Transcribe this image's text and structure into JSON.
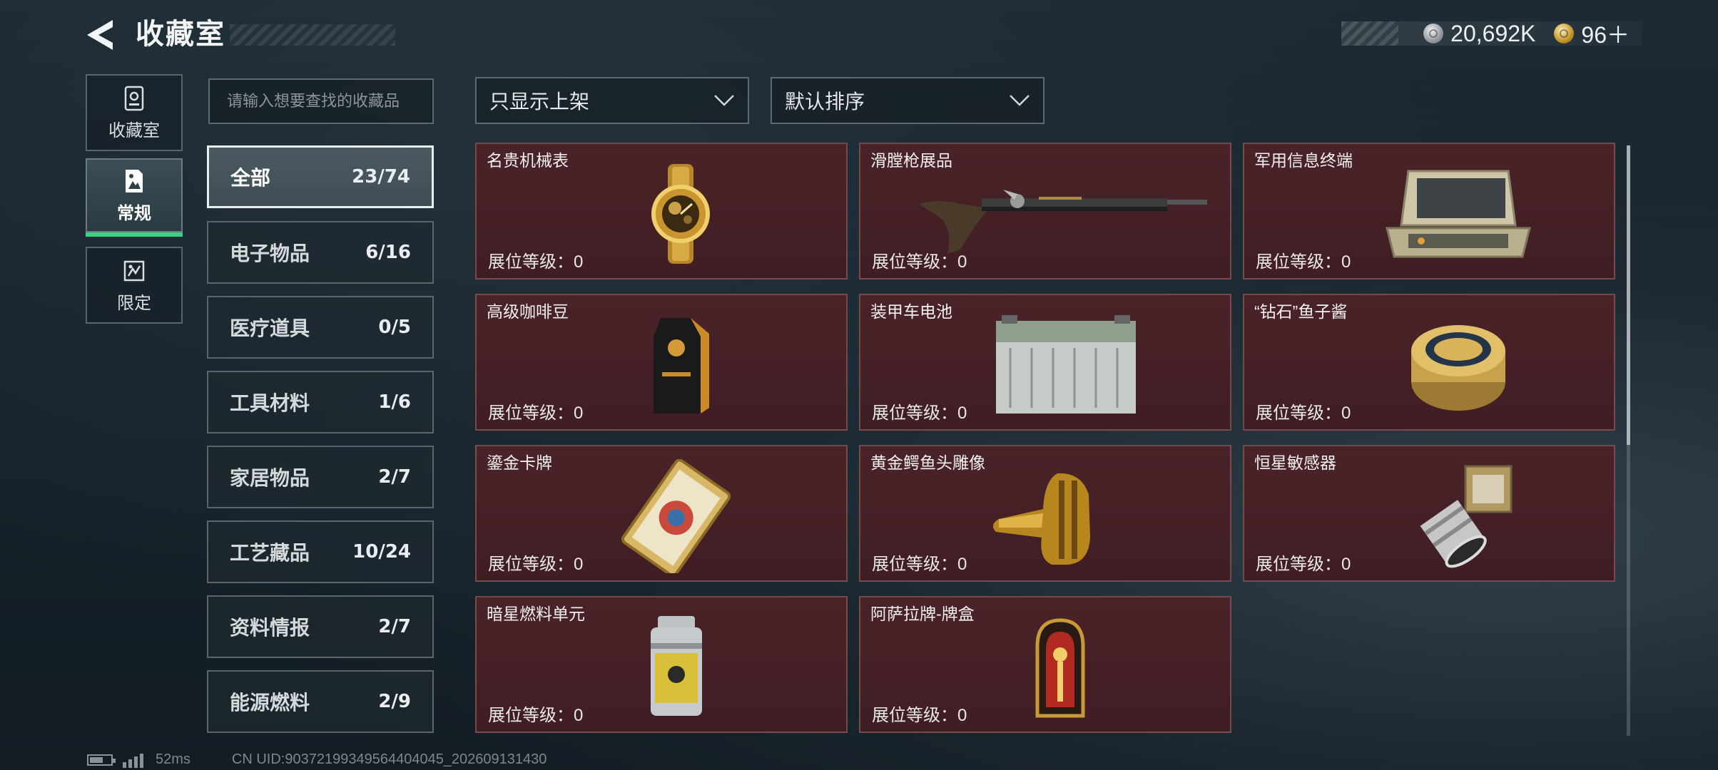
{
  "header": {
    "title": "收藏室"
  },
  "currency": {
    "silver": "20,692K",
    "gold": "96＋"
  },
  "rail": [
    {
      "label": "收藏室",
      "icon": "trophy-case-icon",
      "active": false
    },
    {
      "label": "常规",
      "icon": "document-image-icon",
      "active": true
    },
    {
      "label": "限定",
      "icon": "limited-card-icon",
      "active": false
    }
  ],
  "search": {
    "placeholder": "请输入想要查找的收藏品",
    "value": ""
  },
  "filters": {
    "shelf": "只显示上架",
    "sort": "默认排序"
  },
  "categories": [
    {
      "name": "全部",
      "count": "23/74",
      "active": true
    },
    {
      "name": "电子物品",
      "count": "6/16"
    },
    {
      "name": "医疗道具",
      "count": "0/5"
    },
    {
      "name": "工具材料",
      "count": "1/6"
    },
    {
      "name": "家居物品",
      "count": "2/7"
    },
    {
      "name": "工艺藏品",
      "count": "10/24"
    },
    {
      "name": "资料情报",
      "count": "2/7"
    },
    {
      "name": "能源燃料",
      "count": "2/9"
    }
  ],
  "items": [
    {
      "name": "名贵机械表",
      "level_label": "展位等级：0",
      "icon": "wristwatch-icon"
    },
    {
      "name": "滑膛枪展品",
      "level_label": "展位等级：0",
      "icon": "musket-icon"
    },
    {
      "name": "军用信息终端",
      "level_label": "展位等级：0",
      "icon": "rugged-terminal-icon"
    },
    {
      "name": "高级咖啡豆",
      "level_label": "展位等级：0",
      "icon": "coffee-bag-icon"
    },
    {
      "name": "装甲车电池",
      "level_label": "展位等级：0",
      "icon": "vehicle-battery-icon"
    },
    {
      "name": "“钻石”鱼子酱",
      "level_label": "展位等级：0",
      "icon": "caviar-tin-icon"
    },
    {
      "name": "鎏金卡牌",
      "level_label": "展位等级：0",
      "icon": "gilded-card-icon"
    },
    {
      "name": "黄金鳄鱼头雕像",
      "level_label": "展位等级：0",
      "icon": "golden-crocodile-icon"
    },
    {
      "name": "恒星敏感器",
      "level_label": "展位等级：0",
      "icon": "star-sensor-icon"
    },
    {
      "name": "暗星燃料单元",
      "level_label": "展位等级：0",
      "icon": "fuel-canister-icon"
    },
    {
      "name": "阿萨拉牌-牌盒",
      "level_label": "展位等级：0",
      "icon": "card-box-icon"
    }
  ],
  "footer": {
    "ping": "52ms",
    "uid": "CN UID:903721993495644040​45_202609131430"
  }
}
